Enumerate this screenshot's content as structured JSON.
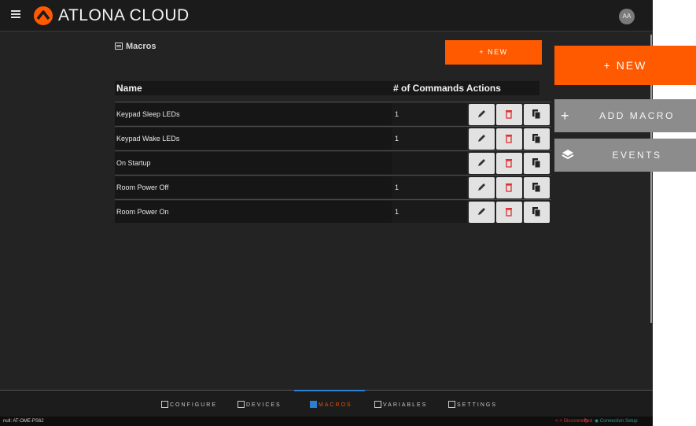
{
  "header": {
    "brand": "ATLONA CLOUD",
    "avatar_initials": "AA"
  },
  "page": {
    "title": "Macros"
  },
  "toolbar": {
    "new_label": "+ NEW"
  },
  "table": {
    "columns": {
      "name": "Name",
      "commands_actions": "# of Commands Actions"
    },
    "rows": [
      {
        "name": "Keypad Sleep LEDs",
        "commands": "1"
      },
      {
        "name": "Keypad Wake LEDs",
        "commands": "1"
      },
      {
        "name": "On Startup",
        "commands": ""
      },
      {
        "name": "Room Power Off",
        "commands": "1"
      },
      {
        "name": "Room Power On",
        "commands": "1"
      }
    ]
  },
  "nav": {
    "items": [
      {
        "label": "CONFIGURE",
        "icon": "configure-icon"
      },
      {
        "label": "DEVICES",
        "icon": "devices-icon"
      },
      {
        "label": "MACROS",
        "icon": "macros-icon",
        "active": true
      },
      {
        "label": "VARIABLES",
        "icon": "variables-icon"
      },
      {
        "label": "SETTINGS",
        "icon": "settings-icon"
      }
    ]
  },
  "status": {
    "device": "null: AT-OME-PS62",
    "connection": "Disconnected",
    "setup_link": "Connection Setup"
  },
  "side_panel": {
    "new_label": "+ NEW",
    "add_macro_label": "ADD MACRO",
    "events_label": "EVENTS"
  },
  "colors": {
    "accent": "#ff5a00",
    "active_nav": "#2a7fd3",
    "danger": "#e03030",
    "link": "#2e9c8c"
  }
}
